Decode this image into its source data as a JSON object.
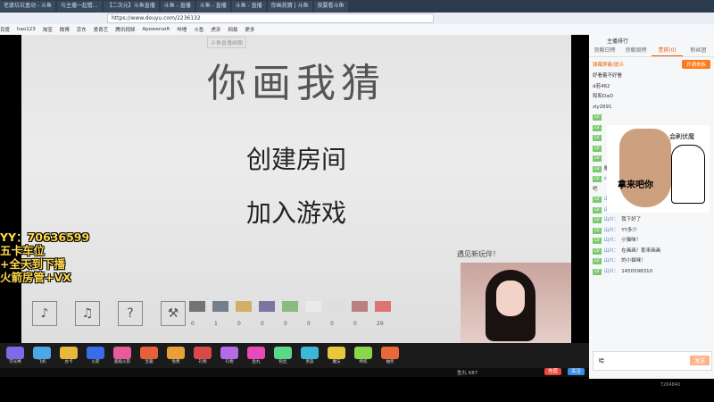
{
  "browser": {
    "tabs": [
      "老婆坑坑盒动 - 斗鱼",
      "与主播一起看...",
      "【二次元】斗鱼直播",
      "斗鱼 - 直播",
      "斗鱼 - 直播",
      "斗鱼 - 直播",
      "你画我猜 | 斗鱼",
      "我要看斗鱼"
    ],
    "url": "https://www.douyu.com/2236132",
    "bookmarks": [
      "百度",
      "hao123",
      "淘宝",
      "微博",
      "京东",
      "爱奇艺",
      "腾讯视频",
      "Apowersoft",
      "哔哩",
      "斗鱼",
      "虎牙",
      "网易",
      "更多"
    ]
  },
  "game": {
    "tag": "斗鱼直播画面",
    "title": "你画我猜",
    "create_room": "创建房间",
    "join_game": "加入游戏",
    "find_partner": "遇见新玩伴！",
    "counts": [
      "0",
      "1",
      "0",
      "0",
      "0",
      "0",
      "0",
      "0",
      "29"
    ]
  },
  "overlay": {
    "line1": "YY：70636599",
    "line2": "五卡车位",
    "line3": "+全天到下播",
    "line4": "火箭房管+VX"
  },
  "gifts": [
    "荧光棒",
    "飞机",
    "办卡",
    "火箭",
    "超级火箭",
    "宝箱",
    "免费",
    "礼物",
    "礼物",
    "鱼丸",
    "粉丝",
    "贵族",
    "魔法",
    "特权",
    "抽奖"
  ],
  "footer": {
    "coins": "鱼丸 687",
    "recharge": "充值",
    "follow": "关注"
  },
  "sidebar": {
    "room_label": "主播排行",
    "tabs": [
      "贡献日榜",
      "贡献周榜",
      "贵宾(0)",
      "粉丝团"
    ],
    "danmaku_hint": "弹幕屏蔽/提示",
    "open_noble": "开通贵族",
    "messages": [
      {
        "lv": "",
        "user": "",
        "text": "好看着不好看"
      },
      {
        "lv": "",
        "user": "",
        "text": "d若462"
      },
      {
        "lv": "",
        "user": "",
        "text": "和和OaO"
      },
      {
        "lv": "",
        "user": "",
        "text": "zly2691"
      },
      {
        "lv": "LV",
        "user": "",
        "text": ""
      },
      {
        "lv": "LV",
        "user": "",
        "text": ""
      },
      {
        "lv": "LV",
        "user": "",
        "text": ""
      },
      {
        "lv": "LV",
        "user": "",
        "text": ""
      },
      {
        "lv": "LV",
        "user": "",
        "text": ""
      },
      {
        "lv": "LV",
        "user": "",
        "text": "暖暖。"
      },
      {
        "lv": "LV",
        "user": "zly1691：",
        "text": "你盘我来小哥"
      },
      {
        "lv": "",
        "user": "",
        "text": "吧"
      },
      {
        "lv": "LV",
        "user": "山川：",
        "text": "主播好棒"
      },
      {
        "lv": "LV",
        "user": "山川：",
        "text": "Draw&Guess"
      },
      {
        "lv": "LV",
        "user": "山川：",
        "text": "我下好了"
      },
      {
        "lv": "LV",
        "user": "山川：",
        "text": "YY多少"
      },
      {
        "lv": "LV",
        "user": "山川：",
        "text": "小猫咪！"
      },
      {
        "lv": "LV",
        "user": "山川：",
        "text": "在画画！那来画画"
      },
      {
        "lv": "LV",
        "user": "山川：",
        "text": "的小猫咪！"
      },
      {
        "lv": "LV",
        "user": "山川：",
        "text": "1450598310"
      }
    ],
    "sticker_top": "会刷伏魔",
    "sticker_text": "拿来吧你",
    "input_value": "哈",
    "send": "发送"
  },
  "bottom_right": "T264840"
}
